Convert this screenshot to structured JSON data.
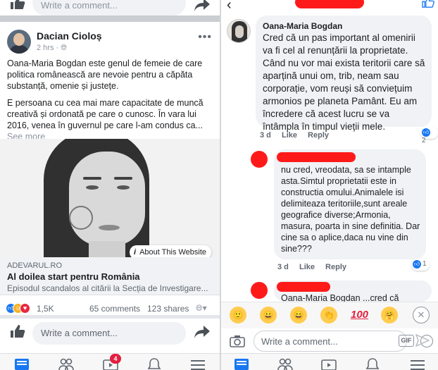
{
  "left": {
    "top_composer": {
      "placeholder": "Write a comment..."
    },
    "post": {
      "author": "Dacian Cioloș",
      "time": "2 hrs",
      "privacy_icon": "globe-icon",
      "more_label": "•••",
      "paragraph1": "Oana-Maria Bogdan este genul de femeie de care politica românească are nevoie pentru a căpăta substanță, omenie și justețe.",
      "paragraph2": "E persoana cu cea mai mare capacitate de muncă creativă și ordonată pe care o cunosc. În vara lui 2016, venea în guvernul pe care l-am condus ca...",
      "see_more": "See more",
      "about_website": "About This Website",
      "link_domain": "ADEVARUL.RO",
      "link_title": "Al doilea start pentru România",
      "link_desc": "Episodul scandalos al citării la Secția de Investigare..."
    },
    "reactions": {
      "count": "1,5K",
      "comments": "65 comments",
      "shares": "123 shares"
    },
    "composer": {
      "placeholder": "Write a comment..."
    },
    "tabs": {
      "watch_badge": "4"
    }
  },
  "right": {
    "comment1": {
      "author": "Oana-Maria Bogdan",
      "text": "Cred că un pas important al omenirii va fi cel al renunțării la proprietate. Când nu vor mai exista teritorii care să aparțină unui om, trib, neam sau corporație, vom reuși să conviețuim armonios pe planeta Pamânt. Eu am încredere că acest lucru se va întâmpla în timpul vieții mele.",
      "time": "3 d",
      "like": "Like",
      "reply": "Reply",
      "likes": "2"
    },
    "comment2": {
      "text": "nu cred, vreodata, sa se intample asta.Simtul proprietatii este in constructia omului.Animalele isi delimiteaza teritoriile,sunt areale geografice diverse;Armonia, masura, poarta in sine definitia. Dar cine sa o aplice,daca nu vine din sine???",
      "time": "3 d",
      "like": "Like",
      "reply": "Reply",
      "likes": "1"
    },
    "comment3": {
      "text": "Oana-Maria Bogdan  ...cred că"
    },
    "emoji_bar": [
      "🙂",
      "😀",
      "😄",
      "👏",
      "100",
      "🤗"
    ],
    "composer": {
      "placeholder": "Write a comment...",
      "gif": "GIF"
    }
  },
  "colors": {
    "facebook_blue": "#1877f2",
    "redaction_red": "#ff1a1a",
    "bubble_gray": "#f0f2f5"
  }
}
